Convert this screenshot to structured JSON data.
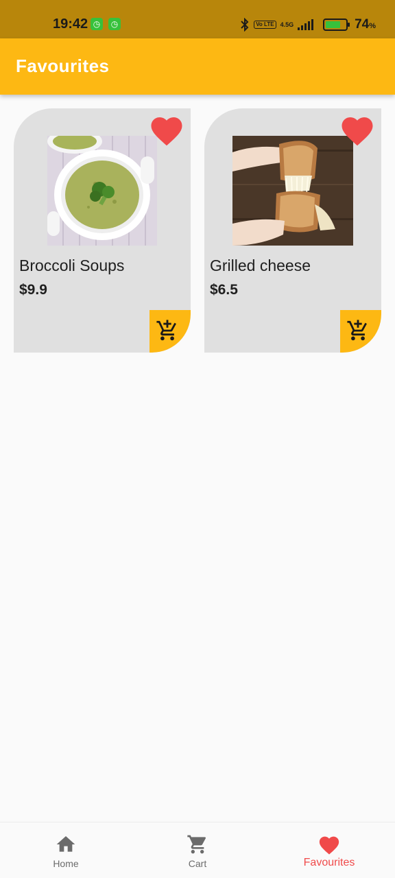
{
  "status_bar": {
    "time": "19:42",
    "network": "4.5G",
    "volte": "Vo LTE",
    "battery_percent": "74",
    "battery_unit": "%",
    "battery_level": 0.74
  },
  "app_bar": {
    "title": "Favourites"
  },
  "favourites": [
    {
      "name": "Broccoli Soups",
      "price": "$9.9",
      "favourite": true
    },
    {
      "name": "Grilled cheese",
      "price": "$6.5",
      "favourite": true
    }
  ],
  "bottom_nav": {
    "items": [
      {
        "label": "Home",
        "icon": "home-icon",
        "active": false
      },
      {
        "label": "Cart",
        "icon": "cart-icon",
        "active": false
      },
      {
        "label": "Favourites",
        "icon": "heart-icon",
        "active": true
      }
    ]
  },
  "colors": {
    "status_bar": "#b8860b",
    "primary": "#fdb813",
    "heart": "#f04a4a",
    "card": "#e0e0e0",
    "inactive_nav": "#6b6b6b"
  }
}
